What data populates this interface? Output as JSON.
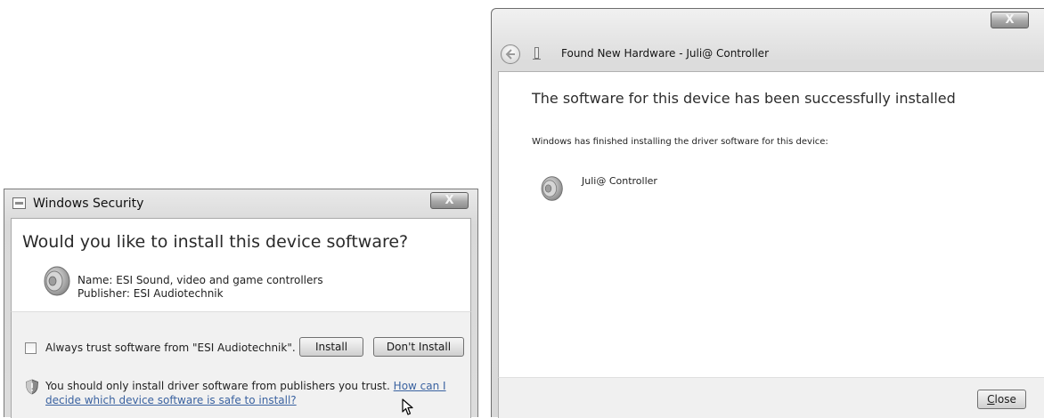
{
  "security_dialog": {
    "title": "Windows Security",
    "close_glyph": "X",
    "heading": "Would you like to install this device software?",
    "device_icon": "speaker-icon",
    "name_line": "Name: ESI Sound, video and game controllers",
    "publisher_line": "Publisher: ESI Audiotechnik",
    "trust_label": "Always trust software from \"ESI Audiotechnik\".",
    "trust_checked": false,
    "install_label": "Install",
    "dont_install_label": "Don't Install",
    "warning_text": "You should only install driver software from publishers you trust.",
    "link_part1": "How can I",
    "link_part2": "decide which device software is safe to install?"
  },
  "hardware_dialog": {
    "close_glyph": "X",
    "title": "Found New Hardware - Juli@ Controller",
    "heading": "The software for this device has been successfully installed",
    "description": "Windows has finished installing the driver software for this device:",
    "device_name": "Juli@ Controller",
    "device_icon": "speaker-icon",
    "close_button_label": "Close"
  },
  "colors": {
    "link": "#3a62a0",
    "window_frame": "#d9d9d9",
    "content_bg": "#ffffff"
  }
}
